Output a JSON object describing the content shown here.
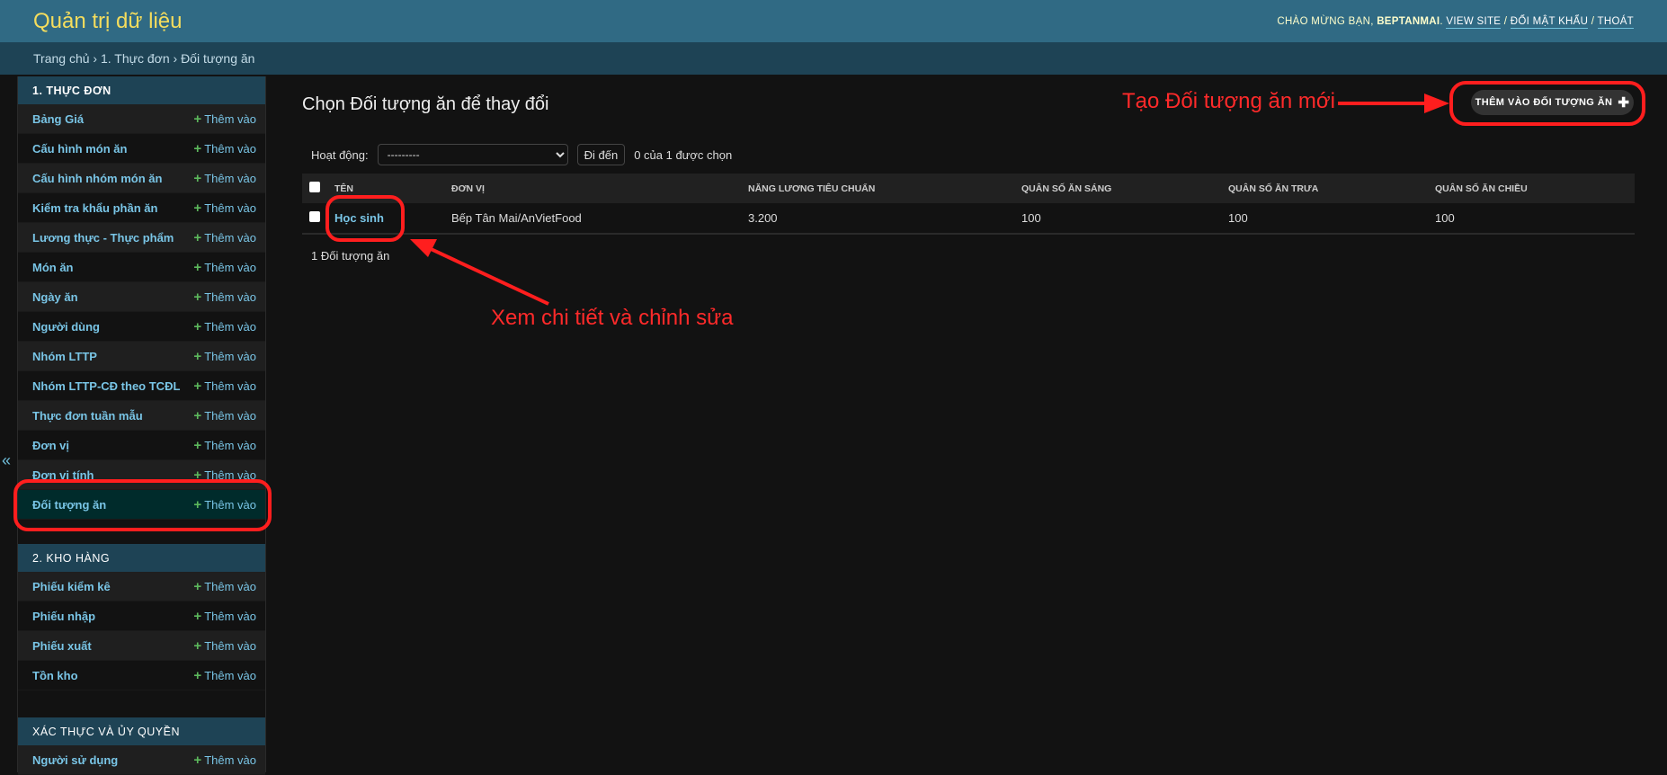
{
  "header": {
    "brand": "Quản trị dữ liệu",
    "welcome": "Chào mừng bạn,",
    "username": "BEPTANMAI",
    "view_site": "View site",
    "change_password": "Đổi mật khẩu",
    "logout": "Thoát"
  },
  "breadcrumb": "Trang chủ › 1. Thực đơn › Đối tượng ăn",
  "sidebar": {
    "add_label": "Thêm vào",
    "collapse_icon": "double-chevron-left-icon",
    "sections": [
      {
        "title": "1. Thực đơn",
        "items": [
          "Bảng Giá",
          "Cấu hình món ăn",
          "Cấu hình nhóm món ăn",
          "Kiểm tra khẩu phần ăn",
          "Lương thực - Thực phẩm",
          "Món ăn",
          "Ngày ăn",
          "Người dùng",
          "Nhóm LTTP",
          "Nhóm LTTP-CĐ theo TCĐL",
          "Thực đơn tuần mẫu",
          "Đơn vị",
          "Đơn vị tính",
          "Đối tượng ăn"
        ],
        "active": "Đối tượng ăn"
      },
      {
        "title": "2. Kho hàng",
        "items": [
          "Phiếu kiểm kê",
          "Phiếu nhập",
          "Phiếu xuất",
          "Tồn kho"
        ]
      },
      {
        "title": "Xác thực và Ủy quyền",
        "items": [
          "Người sử dụng"
        ]
      }
    ]
  },
  "main": {
    "title": "Chọn Đối tượng ăn để thay đổi",
    "add_button": "Thêm vào Đối tượng ăn",
    "action_label": "Hoạt động:",
    "action_value": "---------",
    "go_button": "Đi đến",
    "selected": "0 của 1 được chọn",
    "columns": [
      "Tên",
      "Đơn vị",
      "Năng lương tiêu chuẩn",
      "Quân số ăn sáng",
      "Quân số ăn trưa",
      "Quân số ăn chiều"
    ],
    "rows": [
      [
        "Học sinh",
        "Bếp Tân Mai/AnVietFood",
        "3.200",
        "100",
        "100",
        "100"
      ]
    ],
    "count": "1 Đối tượng ăn"
  },
  "annotations": {
    "create": "Tạo Đối tượng ăn mới",
    "edit": "Xem chi tiết và chỉnh sửa",
    "color": "#ff2a2a"
  }
}
